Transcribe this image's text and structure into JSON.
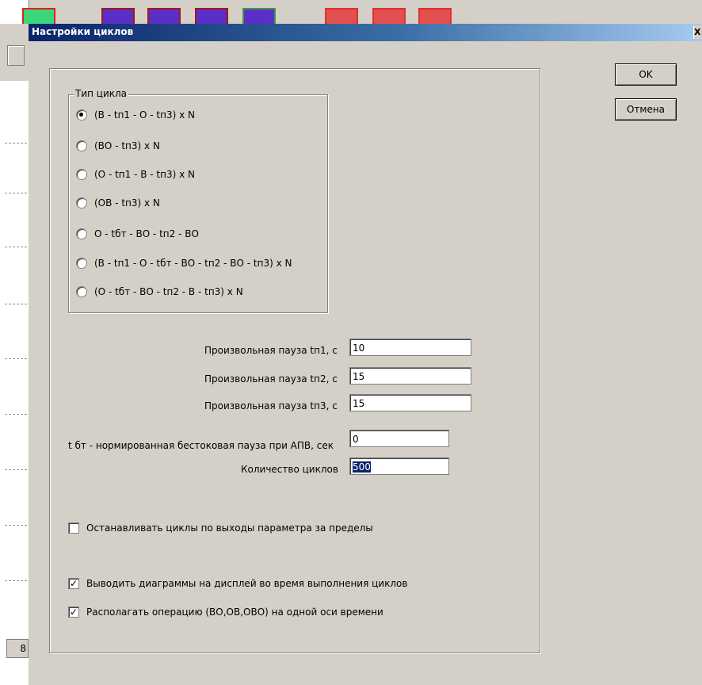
{
  "background": {
    "bottom_tab_text": "8"
  },
  "dialog": {
    "title": "Настройки циклов",
    "close_glyph": "X",
    "ok_label": "OK",
    "cancel_label": "Отмена",
    "cycle_type": {
      "label": "Тип цикла",
      "options": [
        "(В - tп1 - О - tп3) х N",
        "(ВО - tп3) х N",
        "(О - tп1 - В - tп3) х N",
        "(ОВ - tп3) х N",
        "О - tбт - ВО - tп2 - ВО",
        "(В - tп1 - О - tбт - ВО - tп2 - ВО - tп3) х N",
        "(О - tбт - ВО - tп2 - В - tп3) х N"
      ],
      "selected_index": 0
    },
    "pause1": {
      "label": "Произвольная пауза tп1, с",
      "value": "10"
    },
    "pause2": {
      "label": "Произвольная пауза tп2, с",
      "value": "15"
    },
    "pause3": {
      "label": "Произвольная пауза tп3, с",
      "value": "15"
    },
    "dead_pause": {
      "label": "t бт - нормированная бестоковая пауза при АПВ, сек",
      "value": "0"
    },
    "cycle_count": {
      "label": "Количество циклов",
      "value": "500"
    },
    "checkboxes": [
      {
        "label": "Останавливать циклы по выходы параметра за пределы",
        "checked": false
      },
      {
        "label": "Выводить диаграммы на дисплей во время выполнения циклов",
        "checked": true
      },
      {
        "label": "Располагать операцию (ВО,ОВ,ОВО) на одной оси времени",
        "checked": true
      }
    ],
    "check_mark": "✓"
  }
}
